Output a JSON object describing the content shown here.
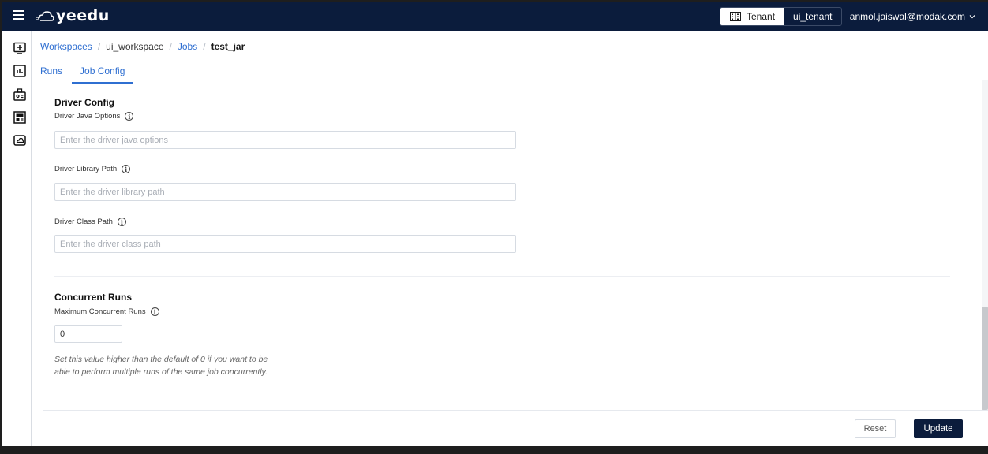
{
  "app": {
    "logo_text": "yeedu"
  },
  "header": {
    "tenant_label": "Tenant",
    "tenant_value": "ui_tenant",
    "user_email": "anmol.jaiswal@modak.com"
  },
  "sidebar": {
    "icons": [
      "add-screen-icon",
      "bar-chart-icon",
      "cluster-icon",
      "layout-icon",
      "cloud-icon"
    ]
  },
  "breadcrumb": {
    "workspaces": "Workspaces",
    "workspace": "ui_workspace",
    "jobs": "Jobs",
    "current": "test_jar",
    "separator": "/"
  },
  "tabs": [
    {
      "label": "Runs",
      "active": false
    },
    {
      "label": "Job Config",
      "active": true
    }
  ],
  "driver_config": {
    "title": "Driver Config",
    "java_options": {
      "label": "Driver Java Options",
      "placeholder": "Enter the driver java options",
      "value": ""
    },
    "library_path": {
      "label": "Driver Library Path",
      "placeholder": "Enter the driver library path",
      "value": ""
    },
    "class_path": {
      "label": "Driver Class Path",
      "placeholder": "Enter the driver class path",
      "value": ""
    }
  },
  "concurrent_runs": {
    "title": "Concurrent Runs",
    "max_label": "Maximum Concurrent Runs",
    "max_value": "0",
    "help_text": "Set this value higher than the default of 0 if you want to be able to perform multiple runs of the same job concurrently."
  },
  "footer": {
    "reset_label": "Reset",
    "update_label": "Update"
  },
  "colors": {
    "navy": "#0b1c3c",
    "link_blue": "#2f6fd1"
  }
}
